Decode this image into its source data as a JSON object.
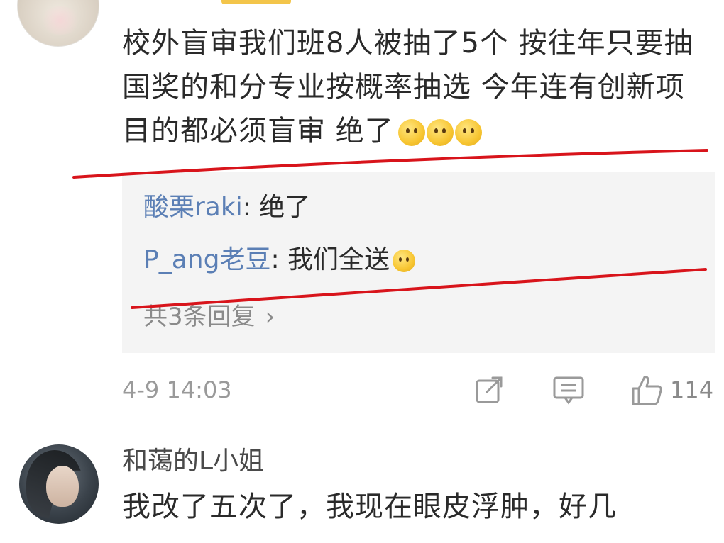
{
  "comment_1": {
    "text": "校外盲审我们班8人被抽了5个 按往年只要抽国奖的和分专业按概率抽选 今年连有创新项目的都必须盲审 绝了",
    "emojis": [
      "smile-emoji",
      "smile-emoji",
      "smile-emoji"
    ],
    "replies": [
      {
        "user": "酸栗raki",
        "separator": ": ",
        "text": "绝了"
      },
      {
        "user": "P_ang老豆",
        "separator": ": ",
        "text": "我们全送"
      }
    ],
    "reply_count_label": "共3条回复",
    "timestamp": "4-9 14:03",
    "like_count": "114"
  },
  "comment_2": {
    "username": "和蔼的L小姐",
    "text": "我改了五次了，我现在眼皮浮肿，好几"
  },
  "colors": {
    "username_link": "#5b7fb5",
    "annotation_red": "#d8141b",
    "reply_background": "#f4f4f4",
    "muted_text": "#9a9a9a"
  },
  "icons": {
    "share": "share-icon",
    "comment": "comment-icon",
    "like": "like-icon",
    "chevron": "chevron-right-icon"
  }
}
